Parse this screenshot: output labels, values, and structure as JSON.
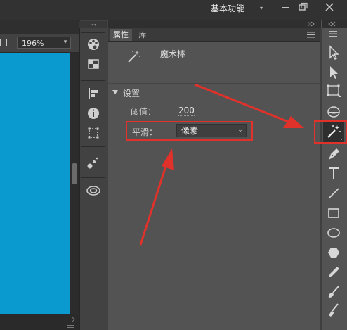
{
  "window": {
    "workspace": "基本功能",
    "minimize_icon": "minimize-icon",
    "restore_icon": "restore-icon",
    "close_icon": "close-icon"
  },
  "stage": {
    "zoom": "196%",
    "canvas_color": "#0b9ad0"
  },
  "properties_panel": {
    "tabs": [
      "属性",
      "库"
    ],
    "tool_name": "魔术棒",
    "section": "设置",
    "threshold_label": "阈值：",
    "threshold_value": "200",
    "smoothing_label": "平滑：",
    "smoothing_value": "像素"
  },
  "annotation_color": "#e0322b",
  "side_panels": [
    "color-swatches-icon",
    "align-icon",
    "info-icon",
    "transform-icon",
    "motion-presets-icon",
    "cc-libraries-icon"
  ],
  "tools": [
    "selection-tool-icon",
    "subselection-tool-icon",
    "free-transform-tool-icon",
    "3d-rotation-tool-icon",
    "magic-wand-tool-icon",
    "pen-tool-icon",
    "text-tool-icon",
    "line-tool-icon",
    "rectangle-tool-icon",
    "oval-tool-icon",
    "polystar-tool-icon",
    "pencil-tool-icon",
    "brush-tool-icon",
    "paint-brush-tool-icon"
  ]
}
